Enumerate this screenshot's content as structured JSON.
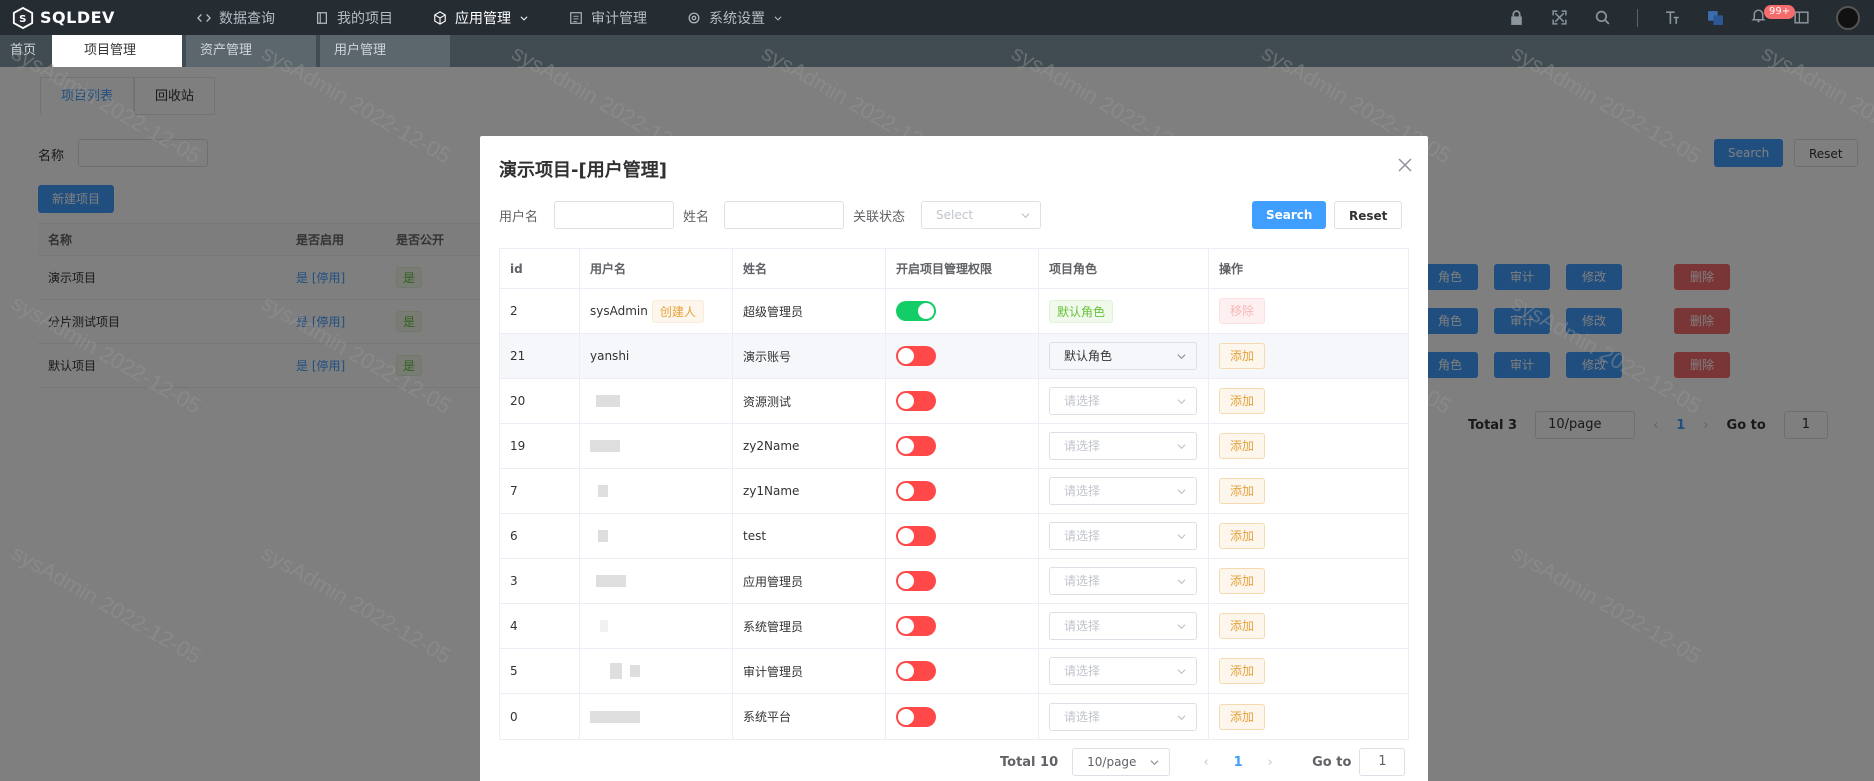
{
  "app": {
    "brand": "SQLDEV"
  },
  "topnav": {
    "items": [
      {
        "label": "数据查询",
        "icon": "code-icon"
      },
      {
        "label": "我的项目",
        "icon": "book-icon"
      },
      {
        "label": "应用管理",
        "icon": "cube-icon",
        "dropdown": true,
        "active": true
      },
      {
        "label": "审计管理",
        "icon": "audit-icon"
      },
      {
        "label": "系统设置",
        "icon": "gear-icon",
        "dropdown": true
      }
    ],
    "badge": "99+"
  },
  "tabs": [
    "首页",
    "项目管理",
    "资产管理",
    "用户管理"
  ],
  "page": {
    "subtabs": [
      "项目列表",
      "回收站"
    ],
    "name_label": "名称",
    "search_label": "Search",
    "reset_label": "Reset",
    "new_project_label": "新建项目",
    "table_headers": [
      "名称",
      "是否启用",
      "是否公开"
    ],
    "rows": [
      {
        "name": "演示项目",
        "enabled": "是 [停用]",
        "public": "是"
      },
      {
        "name": "分片测试项目",
        "enabled": "是 [停用]",
        "public": "是"
      },
      {
        "name": "默认项目",
        "enabled": "是 [停用]",
        "public": "是"
      }
    ],
    "row_actions": [
      "角色",
      "审计",
      "修改",
      "删除"
    ],
    "pager": {
      "total": "Total 3",
      "page_size": "10/page",
      "current": "1",
      "goto_label": "Go to",
      "goto_value": "1"
    }
  },
  "watermark": "sysAdmin 2022-12-05",
  "modal": {
    "title": "演示项目-[用户管理]",
    "filters": {
      "username_label": "用户名",
      "name_label": "姓名",
      "status_label": "关联状态",
      "status_placeholder": "Select",
      "search_label": "Search",
      "reset_label": "Reset"
    },
    "headers": [
      "id",
      "用户名",
      "姓名",
      "开启项目管理权限",
      "项目角色",
      "操作"
    ],
    "rows": [
      {
        "id": "2",
        "username": "sysAdmin",
        "creator": "创建人",
        "name": "超级管理员",
        "switch": true,
        "role": "默认角色",
        "role_type": "tag",
        "action": "移除"
      },
      {
        "id": "21",
        "username": "yanshi",
        "name": "演示账号",
        "switch": false,
        "role": "默认角色",
        "role_type": "select",
        "action": "添加"
      },
      {
        "id": "20",
        "username": "",
        "name": "资源测试",
        "switch": false,
        "role": "请选择",
        "role_type": "placeholder",
        "action": "添加"
      },
      {
        "id": "19",
        "username": "",
        "name": "zy2Name",
        "switch": false,
        "role": "请选择",
        "role_type": "placeholder",
        "action": "添加"
      },
      {
        "id": "7",
        "username": "",
        "name": "zy1Name",
        "switch": false,
        "role": "请选择",
        "role_type": "placeholder",
        "action": "添加"
      },
      {
        "id": "6",
        "username": "",
        "name": "test",
        "switch": false,
        "role": "请选择",
        "role_type": "placeholder",
        "action": "添加"
      },
      {
        "id": "3",
        "username": "",
        "name": "应用管理员",
        "switch": false,
        "role": "请选择",
        "role_type": "placeholder",
        "action": "添加"
      },
      {
        "id": "4",
        "username": "",
        "name": "系统管理员",
        "switch": false,
        "role": "请选择",
        "role_type": "placeholder",
        "action": "添加"
      },
      {
        "id": "5",
        "username": "",
        "name": "审计管理员",
        "switch": false,
        "role": "请选择",
        "role_type": "placeholder",
        "action": "添加"
      },
      {
        "id": "0",
        "username": "",
        "name": "系统平台",
        "switch": false,
        "role": "请选择",
        "role_type": "placeholder",
        "action": "添加"
      }
    ],
    "pager": {
      "total": "Total 10",
      "page_size": "10/page",
      "current": "1",
      "goto_label": "Go to",
      "goto_value": "1"
    }
  },
  "colors": {
    "primary": "#409eff",
    "danger": "#f56c6c",
    "success": "#13ce66",
    "warning": "#e6a23c",
    "nav_bg": "#252d33"
  }
}
